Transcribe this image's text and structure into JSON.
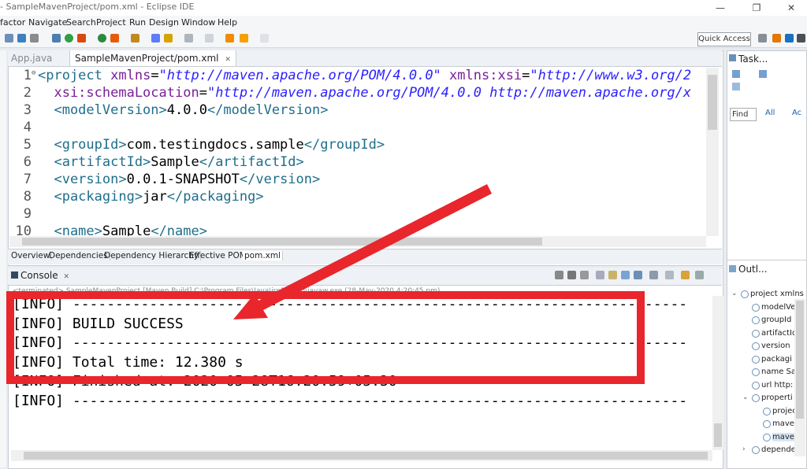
{
  "window": {
    "title": "- SampleMavenProject/pom.xml - Eclipse IDE",
    "minimize_glyph": "—",
    "restore_glyph": "❐",
    "close_glyph": "✕"
  },
  "menu": [
    "factor",
    "Navigate",
    "Search",
    "Project",
    "Run",
    "Design",
    "Window",
    "Help"
  ],
  "toolbar": {
    "quick_access": "Quick Access"
  },
  "editor": {
    "tabs": [
      {
        "label": "App.java",
        "active": false
      },
      {
        "label": "SampleMavenProject/pom.xml",
        "close": "✕",
        "active": true
      }
    ],
    "code_lines": [
      {
        "no": "1",
        "fold": "⊖",
        "parts": [
          {
            "t": "tag",
            "v": "<project "
          },
          {
            "t": "attr",
            "v": "xmlns"
          },
          {
            "t": "txt",
            "v": "="
          },
          {
            "t": "str",
            "v": "\"http://maven.apache.org/POM/4.0.0\""
          },
          {
            "t": "txt",
            "v": " "
          },
          {
            "t": "attr",
            "v": "xmlns:xsi"
          },
          {
            "t": "txt",
            "v": "="
          },
          {
            "t": "str",
            "v": "\"http://www.w3.org/2"
          }
        ]
      },
      {
        "no": "2",
        "parts": [
          {
            "t": "attr",
            "v": "  xsi:schemaLocation"
          },
          {
            "t": "txt",
            "v": "="
          },
          {
            "t": "str",
            "v": "\"http://maven.apache.org/POM/4.0.0 http://maven.apache.org/x"
          }
        ]
      },
      {
        "no": "3",
        "parts": [
          {
            "t": "tag",
            "v": "  <modelVersion>"
          },
          {
            "t": "txt",
            "v": "4.0.0"
          },
          {
            "t": "tag",
            "v": "</modelVersion>"
          }
        ]
      },
      {
        "no": "4",
        "parts": []
      },
      {
        "no": "5",
        "parts": [
          {
            "t": "tag",
            "v": "  <groupId>"
          },
          {
            "t": "txt",
            "v": "com.testingdocs.sample"
          },
          {
            "t": "tag",
            "v": "</groupId>"
          }
        ]
      },
      {
        "no": "6",
        "parts": [
          {
            "t": "tag",
            "v": "  <artifactId>"
          },
          {
            "t": "txt",
            "v": "Sample"
          },
          {
            "t": "tag",
            "v": "</artifactId>"
          }
        ]
      },
      {
        "no": "7",
        "parts": [
          {
            "t": "tag",
            "v": "  <version>"
          },
          {
            "t": "txt",
            "v": "0.0.1-SNAPSHOT"
          },
          {
            "t": "tag",
            "v": "</version>"
          }
        ]
      },
      {
        "no": "8",
        "parts": [
          {
            "t": "tag",
            "v": "  <packaging>"
          },
          {
            "t": "txt",
            "v": "jar"
          },
          {
            "t": "tag",
            "v": "</packaging>"
          }
        ]
      },
      {
        "no": "9",
        "parts": []
      },
      {
        "no": "10",
        "parts": [
          {
            "t": "tag",
            "v": "  <name>"
          },
          {
            "t": "txt",
            "v": "Sample"
          },
          {
            "t": "tag",
            "v": "</name>"
          }
        ]
      }
    ],
    "bottom_tabs": [
      "Overview",
      "Dependencies",
      "Dependency Hierarchy",
      "Effective POM",
      "pom.xml"
    ]
  },
  "task_panel": {
    "title": "Task...",
    "find_placeholder": "Find",
    "all_label": "All",
    "ac_label": "Ac"
  },
  "outline_panel": {
    "title": "Outl...",
    "items": [
      {
        "label": "project xmlns",
        "indent": 0,
        "expand": "⌄"
      },
      {
        "label": "modelVe",
        "indent": 1
      },
      {
        "label": "groupId",
        "indent": 1
      },
      {
        "label": "artifactId",
        "indent": 1
      },
      {
        "label": "version",
        "indent": 1
      },
      {
        "label": "packagi",
        "indent": 1
      },
      {
        "label": "name Sa",
        "indent": 1
      },
      {
        "label": "url http:",
        "indent": 1
      },
      {
        "label": "properti",
        "indent": 1,
        "expand": "⌄"
      },
      {
        "label": "projec",
        "indent": 2
      },
      {
        "label": "mave",
        "indent": 2
      },
      {
        "label": "mave",
        "indent": 2,
        "selected": true
      },
      {
        "label": "depende",
        "indent": 1,
        "expand": "›"
      }
    ]
  },
  "console": {
    "title": "Console",
    "close": "✕",
    "status": "<terminated> SampleMavenProject [Maven Build] C:\\Program Files\\Java\\jre1.8\\bin\\javaw.exe (28-May-2020 4:20:45 pm)",
    "lines": [
      "[INFO] ------------------------------------------------------------------------",
      "[INFO] BUILD SUCCESS",
      "[INFO] ------------------------------------------------------------------------",
      "[INFO] Total time:  12.380 s",
      "[INFO] Finished at: 2020-05-28T16:20:59+05:30",
      "[INFO] ------------------------------------------------------------------------"
    ]
  },
  "colors": {
    "highlight": "#e8262c",
    "tag": "#1e6e8a",
    "attr": "#7a1f9a",
    "string": "#2a1fff"
  }
}
